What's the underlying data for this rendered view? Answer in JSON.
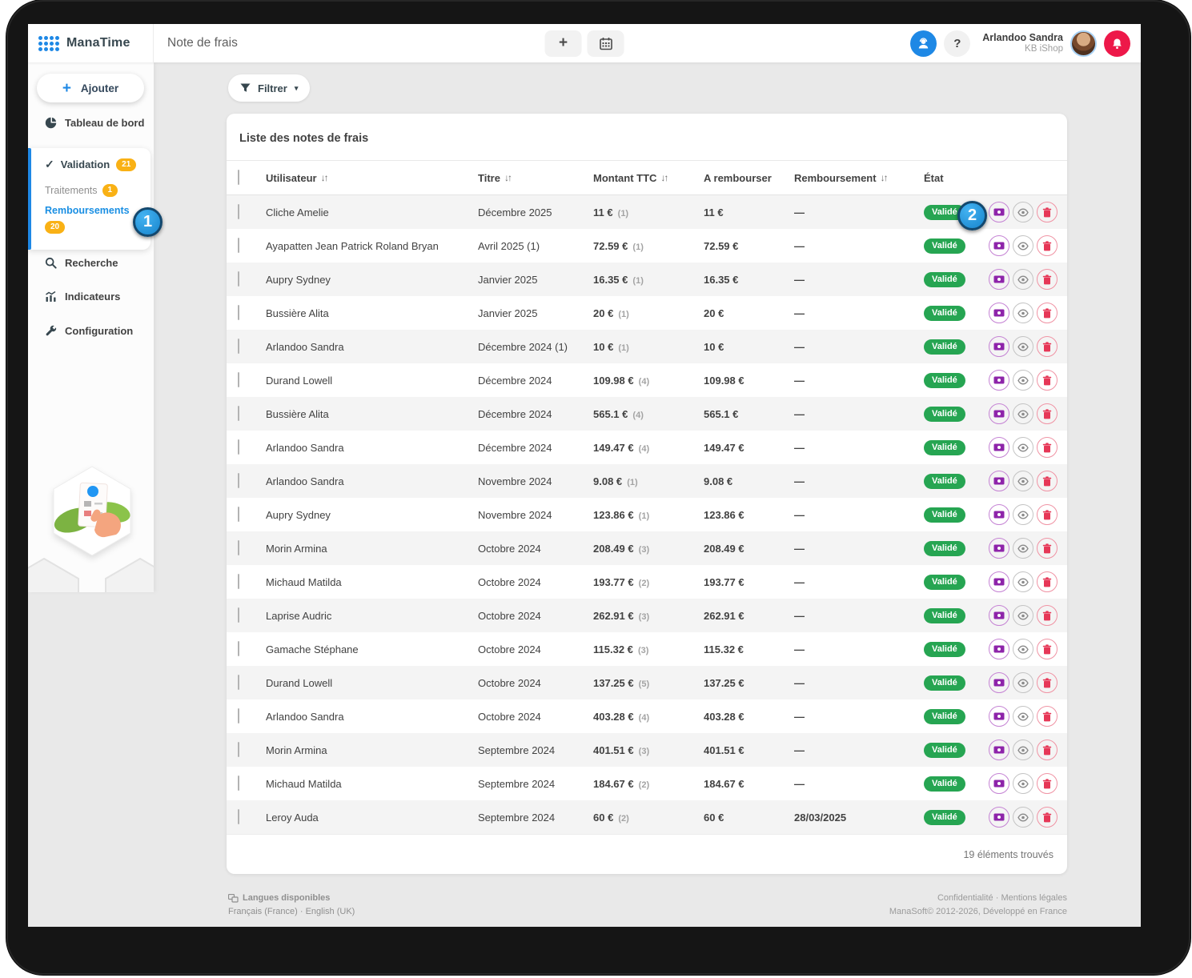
{
  "header": {
    "brand": "ManaTime",
    "page_title": "Note de frais",
    "user_name": "Arlandoo Sandra",
    "user_org": "KB iShop"
  },
  "icons": {
    "plus": "+",
    "help": "?",
    "check": "✓",
    "sort": "↓↑",
    "caret": "▾"
  },
  "sidebar": {
    "add_label": "Ajouter",
    "dashboard_label": "Tableau de bord",
    "validation_label": "Validation",
    "validation_badge": "21",
    "traitements_label": "Traitements",
    "traitements_badge": "1",
    "remboursements_label": "Remboursements",
    "remboursements_badge": "20",
    "recherche_label": "Recherche",
    "indicateurs_label": "Indicateurs",
    "configuration_label": "Configuration"
  },
  "toolbar": {
    "filter_label": "Filtrer"
  },
  "table": {
    "title": "Liste des notes de frais",
    "columns": {
      "user": "Utilisateur",
      "title": "Titre",
      "amount": "Montant TTC",
      "to_reimburse": "A rembourser",
      "reimbursement": "Remboursement",
      "status": "État"
    },
    "rows": [
      {
        "user": "Cliche Amelie",
        "title": "Décembre 2025",
        "amount": "11 €",
        "count": "(1)",
        "to_reimburse": "11 €",
        "reimbursement": "—",
        "status": "Validé"
      },
      {
        "user": "Ayapatten Jean Patrick Roland Bryan",
        "title": "Avril 2025 (1)",
        "amount": "72.59 €",
        "count": "(1)",
        "to_reimburse": "72.59 €",
        "reimbursement": "—",
        "status": "Validé"
      },
      {
        "user": "Aupry Sydney",
        "title": "Janvier 2025",
        "amount": "16.35 €",
        "count": "(1)",
        "to_reimburse": "16.35 €",
        "reimbursement": "—",
        "status": "Validé"
      },
      {
        "user": "Bussière Alita",
        "title": "Janvier 2025",
        "amount": "20 €",
        "count": "(1)",
        "to_reimburse": "20 €",
        "reimbursement": "—",
        "status": "Validé"
      },
      {
        "user": "Arlandoo Sandra",
        "title": "Décembre 2024 (1)",
        "amount": "10 €",
        "count": "(1)",
        "to_reimburse": "10 €",
        "reimbursement": "—",
        "status": "Validé"
      },
      {
        "user": "Durand Lowell",
        "title": "Décembre 2024",
        "amount": "109.98 €",
        "count": "(4)",
        "to_reimburse": "109.98 €",
        "reimbursement": "—",
        "status": "Validé"
      },
      {
        "user": "Bussière Alita",
        "title": "Décembre 2024",
        "amount": "565.1 €",
        "count": "(4)",
        "to_reimburse": "565.1 €",
        "reimbursement": "—",
        "status": "Validé"
      },
      {
        "user": "Arlandoo Sandra",
        "title": "Décembre 2024",
        "amount": "149.47 €",
        "count": "(4)",
        "to_reimburse": "149.47 €",
        "reimbursement": "—",
        "status": "Validé"
      },
      {
        "user": "Arlandoo Sandra",
        "title": "Novembre 2024",
        "amount": "9.08 €",
        "count": "(1)",
        "to_reimburse": "9.08 €",
        "reimbursement": "—",
        "status": "Validé"
      },
      {
        "user": "Aupry Sydney",
        "title": "Novembre 2024",
        "amount": "123.86 €",
        "count": "(1)",
        "to_reimburse": "123.86 €",
        "reimbursement": "—",
        "status": "Validé"
      },
      {
        "user": "Morin Armina",
        "title": "Octobre 2024",
        "amount": "208.49 €",
        "count": "(3)",
        "to_reimburse": "208.49 €",
        "reimbursement": "—",
        "status": "Validé"
      },
      {
        "user": "Michaud Matilda",
        "title": "Octobre 2024",
        "amount": "193.77 €",
        "count": "(2)",
        "to_reimburse": "193.77 €",
        "reimbursement": "—",
        "status": "Validé"
      },
      {
        "user": "Laprise Audric",
        "title": "Octobre 2024",
        "amount": "262.91 €",
        "count": "(3)",
        "to_reimburse": "262.91 €",
        "reimbursement": "—",
        "status": "Validé"
      },
      {
        "user": "Gamache Stéphane",
        "title": "Octobre 2024",
        "amount": "115.32 €",
        "count": "(3)",
        "to_reimburse": "115.32 €",
        "reimbursement": "—",
        "status": "Validé"
      },
      {
        "user": "Durand Lowell",
        "title": "Octobre 2024",
        "amount": "137.25 €",
        "count": "(5)",
        "to_reimburse": "137.25 €",
        "reimbursement": "—",
        "status": "Validé"
      },
      {
        "user": "Arlandoo Sandra",
        "title": "Octobre 2024",
        "amount": "403.28 €",
        "count": "(4)",
        "to_reimburse": "403.28 €",
        "reimbursement": "—",
        "status": "Validé"
      },
      {
        "user": "Morin Armina",
        "title": "Septembre 2024",
        "amount": "401.51 €",
        "count": "(3)",
        "to_reimburse": "401.51 €",
        "reimbursement": "—",
        "status": "Validé"
      },
      {
        "user": "Michaud Matilda",
        "title": "Septembre 2024",
        "amount": "184.67 €",
        "count": "(2)",
        "to_reimburse": "184.67 €",
        "reimbursement": "—",
        "status": "Validé"
      },
      {
        "user": "Leroy Auda",
        "title": "Septembre 2024",
        "amount": "60 €",
        "count": "(2)",
        "to_reimburse": "60 €",
        "reimbursement": "28/03/2025",
        "status": "Validé"
      }
    ],
    "results_count": "19 éléments trouvés"
  },
  "annotations": {
    "step1": "1",
    "step2": "2"
  },
  "footer": {
    "languages_label": "Langues disponibles",
    "languages_options": "Français (France) · English (UK)",
    "legal_links": "Confidentialité · Mentions légales",
    "copyright": "ManaSoft© 2012-2026, Développé en France"
  },
  "colors": {
    "accent_blue": "#1e88e5",
    "badge_yellow": "#f9b115",
    "status_green": "#26a552",
    "action_purple": "#8e24aa",
    "action_red": "#e63757",
    "logout_red": "#ed1849"
  }
}
